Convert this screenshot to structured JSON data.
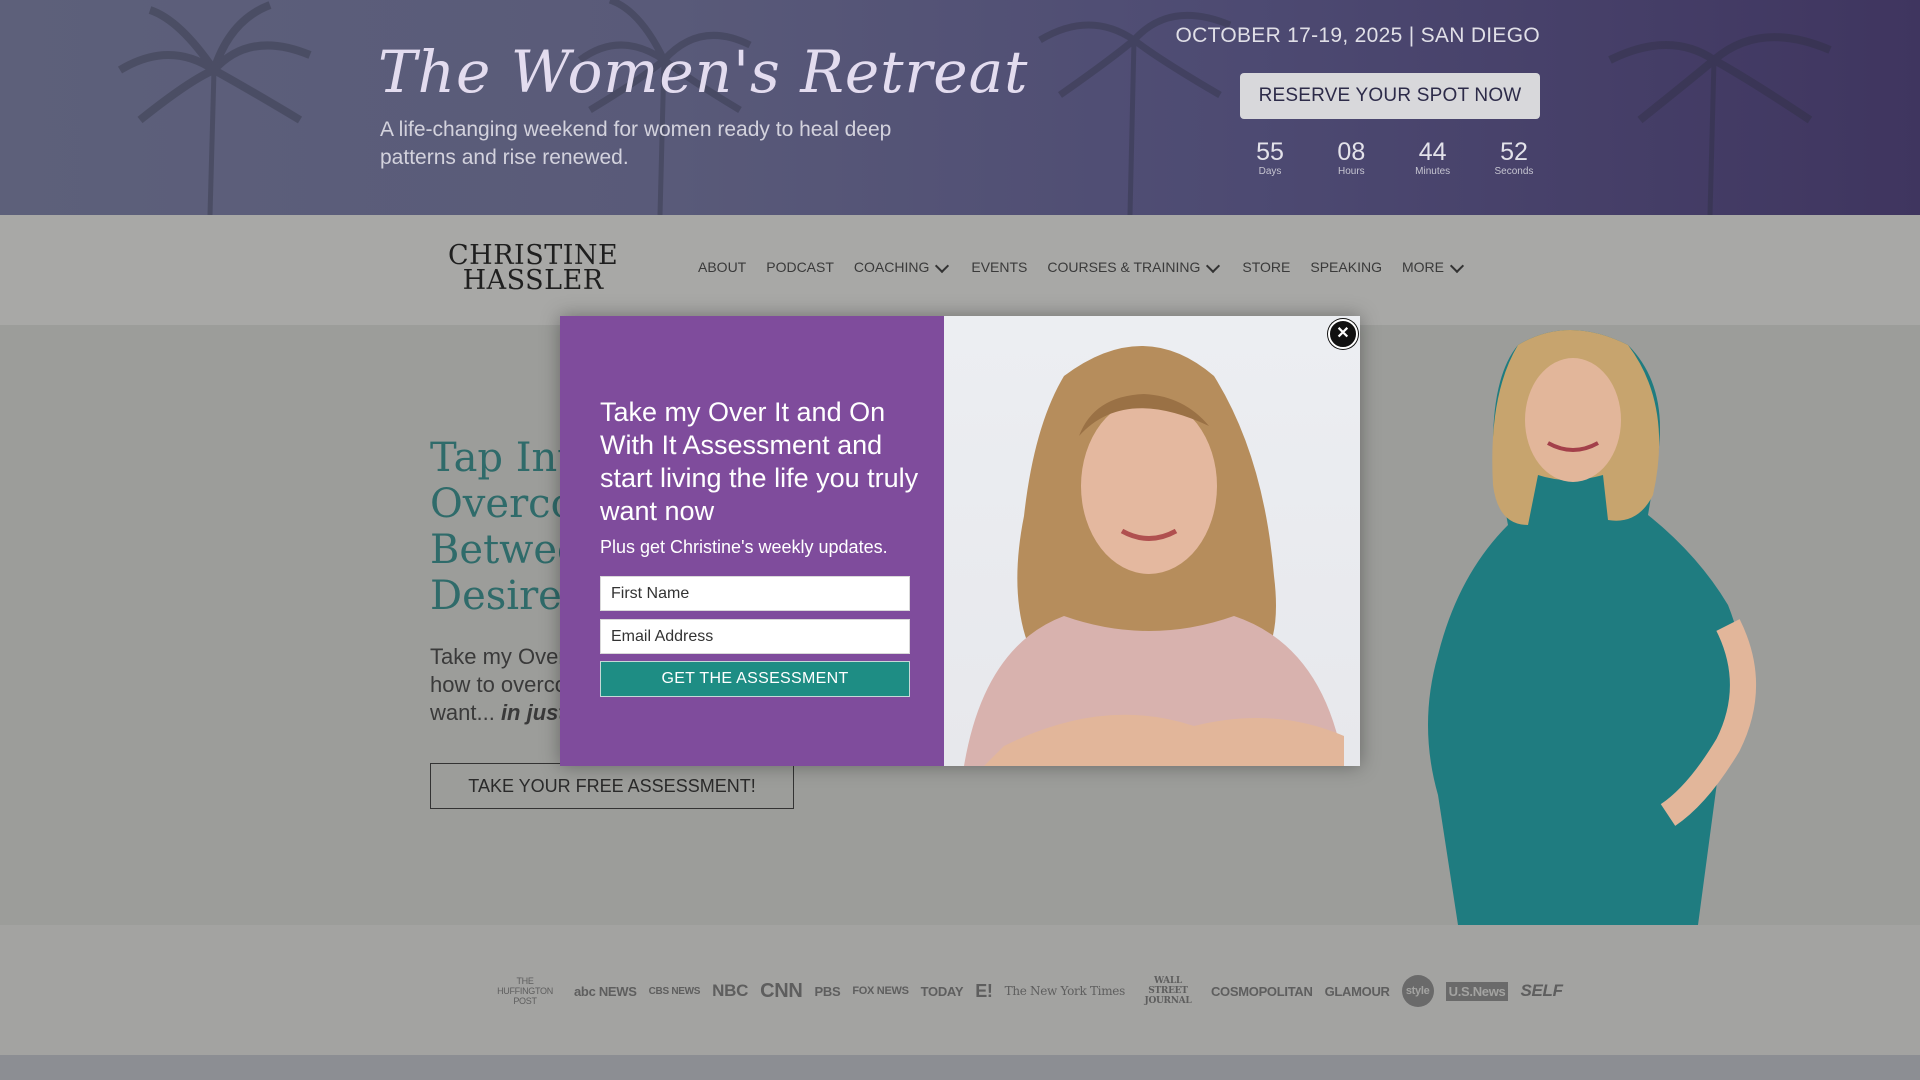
{
  "banner": {
    "title": "The Women's Retreat",
    "subtitle": "A life-changing weekend for women ready to heal deep patterns and rise renewed.",
    "date_location": "OCTOBER 17-19, 2025 | SAN DIEGO",
    "reserve_label": "RESERVE YOUR SPOT NOW",
    "countdown": [
      {
        "value": "55",
        "label": "Days"
      },
      {
        "value": "08",
        "label": "Hours"
      },
      {
        "value": "44",
        "label": "Minutes"
      },
      {
        "value": "52",
        "label": "Seconds"
      }
    ]
  },
  "logo": {
    "line1": "CHRISTINE",
    "line2": "HASSLER"
  },
  "nav": {
    "items": [
      {
        "label": "ABOUT",
        "dropdown": false
      },
      {
        "label": "PODCAST",
        "dropdown": false
      },
      {
        "label": "COACHING",
        "dropdown": true
      },
      {
        "label": "EVENTS",
        "dropdown": false
      },
      {
        "label": "COURSES & TRAINING",
        "dropdown": true
      },
      {
        "label": "STORE",
        "dropdown": false
      },
      {
        "label": "SPEAKING",
        "dropdown": false
      },
      {
        "label": "MORE",
        "dropdown": true
      }
    ]
  },
  "hero": {
    "heading_lines": [
      "Tap Int",
      "Overco",
      "Betwee",
      "Desire."
    ],
    "text_lines": [
      "Take my Over",
      "how to overco",
      "want..."
    ],
    "text_emphasis": "in just t",
    "cta_label": "TAKE YOUR FREE ASSESSMENT!"
  },
  "popup": {
    "heading": "Take my Over It and On With It Assessment and start living the life you truly want now",
    "subheading": "Plus get Christine's weekly updates.",
    "first_name_placeholder": "First Name",
    "email_placeholder": "Email Address",
    "submit_label": "GET THE ASSESSMENT",
    "close_symbol": "✕"
  },
  "press_logos": [
    "THE HUFFINGTON POST",
    "abc NEWS",
    "CBS NEWS",
    "NBC",
    "CNN",
    "PBS",
    "FOX NEWS",
    "TODAY",
    "E!",
    "The New York Times",
    "WALL STREET JOURNAL",
    "COSMOPOLITAN",
    "GLAMOUR",
    "style",
    "U.S.News",
    "SELF"
  ],
  "colors": {
    "popup_purple": "#7f4c9c",
    "submit_teal": "#1e8d84",
    "hero_heading_teal": "#2f6b6a"
  }
}
